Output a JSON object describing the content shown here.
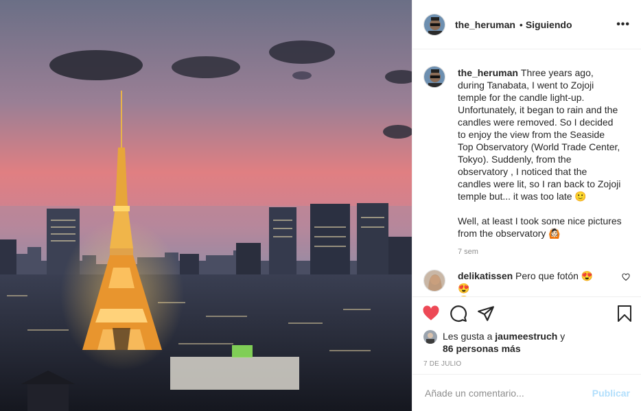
{
  "post": {
    "photo_alt": "",
    "author": "the_heruman",
    "separator": "•",
    "following_label": "Siguiendo",
    "more_label": "•••",
    "caption": "Three years ago, during Tanabata, I went to Zojoji temple for the candle light-up. Unfortunately, it began to rain and the candles were removed. So I decided to enjoy the view from the Seaside Top Observatory (World Trade Center, Tokyo). Suddenly, from the observatory , I noticed that the candles were lit, so I ran back to Zojoji temple but... it was too late 🙂\n\nWell, at least I took some nice pictures from the observatory 🙆🏻",
    "caption_time": "7 sem",
    "comments": [
      {
        "user": "delikatissen",
        "text": "Pero que fotón 😍😍\n😍"
      }
    ],
    "likes_prefix": "Les gusta a",
    "likes_user": "jaumeestruch",
    "likes_and": "y",
    "likes_others": "86 personas más",
    "date": "7 DE JULIO",
    "comment_placeholder": "Añade un comentario...",
    "publish_label": "Publicar"
  },
  "icons": {
    "like": "heart-filled-icon",
    "comment": "comment-icon",
    "share": "paper-plane-icon",
    "save": "bookmark-icon",
    "comment_like": "heart-outline-icon"
  },
  "colors": {
    "like_red": "#ed4956",
    "publish_blue": "#b2dffc",
    "muted": "#8e8e8e",
    "text": "#262626"
  }
}
